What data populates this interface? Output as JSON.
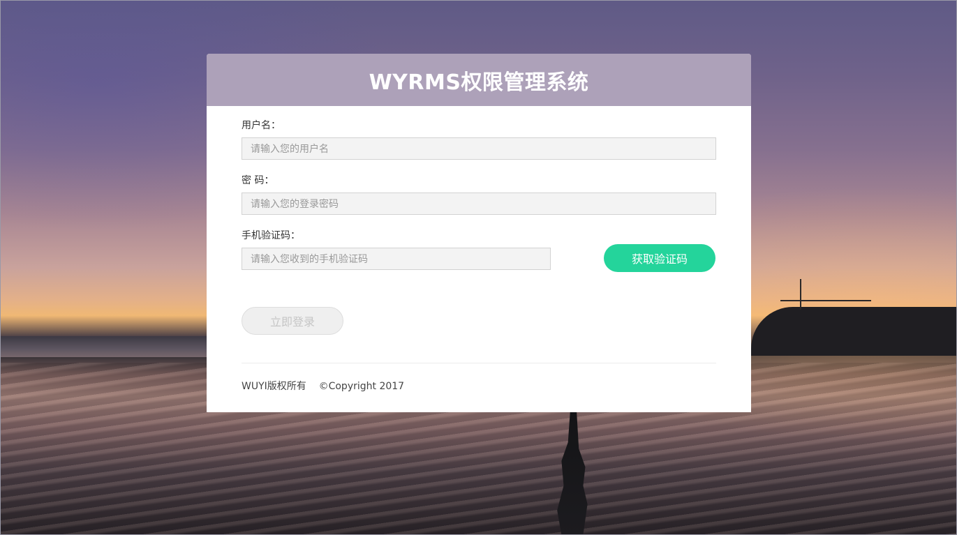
{
  "app": {
    "title": "WYRMS权限管理系统"
  },
  "form": {
    "username": {
      "label": "用户名：",
      "placeholder": "请输入您的用户名",
      "value": ""
    },
    "password": {
      "label": "密 码：",
      "placeholder": "请输入您的登录密码",
      "value": ""
    },
    "sms_code": {
      "label": "手机验证码：",
      "placeholder": "请输入您收到的手机验证码",
      "value": ""
    },
    "get_code_button": "获取验证码",
    "login_button": "立即登录"
  },
  "footer": {
    "copyright_owner": "WUYI版权所有",
    "copyright_text": "©Copyright 2017"
  },
  "colors": {
    "accent": "#24d49b",
    "header_bg": "#9687a5",
    "login_disabled": "#efefef"
  }
}
